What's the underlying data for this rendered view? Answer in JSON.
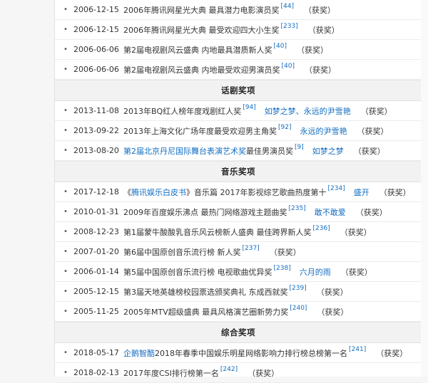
{
  "rows": [
    {
      "date": "2006-12-15",
      "pre": "",
      "link": "",
      "event": "2006年腾讯网星光大典 最具潜力电影演员奖",
      "ref": "[44]",
      "work": "",
      "result": "（获奖）"
    },
    {
      "date": "2006-12-15",
      "pre": "",
      "link": "",
      "event": "2006年腾讯网星光大典 最受欢迎四大小生奖",
      "ref": "[233]",
      "work": "",
      "result": "（获奖）"
    },
    {
      "date": "2006-06-06",
      "pre": "",
      "link": "",
      "event": "第2届电视剧风云盛典 内地最具潜质新人奖",
      "ref": "[40]",
      "work": "",
      "result": "（获奖）"
    },
    {
      "date": "2006-06-06",
      "pre": "",
      "link": "",
      "event": "第2届电视剧风云盛典 内地最受欢迎男演员奖",
      "ref": "[40]",
      "work": "",
      "result": "（获奖）"
    }
  ],
  "sections": {
    "drama": "话剧奖项",
    "music": "音乐奖项",
    "general": "综合奖项"
  },
  "drama_rows": [
    {
      "date": "2013-11-08",
      "pre": "",
      "link": "",
      "event": "2013年BQ红人榜年度戏剧红人奖",
      "ref": "[94]",
      "work": "如梦之梦、永远的尹雪艳",
      "result": "（获奖）"
    },
    {
      "date": "2013-09-22",
      "pre": "",
      "link": "",
      "event": "2013年上海文化广场年度最受欢迎男主角奖",
      "ref": "[92]",
      "work": "永远的尹雪艳",
      "result": "（获奖）"
    },
    {
      "date": "2013-08-20",
      "pre": "",
      "link": "第2届北京丹尼国际舞台表演艺术奖",
      "event": "最佳男演员奖",
      "ref": "[9]",
      "work": "如梦之梦",
      "result": "（获奖）"
    }
  ],
  "music_rows": [
    {
      "date": "2017-12-18",
      "pre": "《",
      "link": "腾讯娱乐白皮书",
      "event": "》音乐篇 2017年影视综艺歌曲热度第十",
      "ref": "[234]",
      "work": "盛开",
      "result": "（获奖）"
    },
    {
      "date": "2010-01-31",
      "pre": "",
      "link": "",
      "event": "2009年百度娱乐沸点 最热门网络游戏主题曲奖",
      "ref": "[235]",
      "work": "敢不敢爱",
      "result": "（获奖）"
    },
    {
      "date": "2008-12-23",
      "pre": "",
      "link": "",
      "event": "第1届蒙牛酸酸乳音乐风云榜新人盛典 最佳跨界新人奖",
      "ref": "[236]",
      "work": "",
      "result": "（获奖）"
    },
    {
      "date": "2007-01-20",
      "pre": "",
      "link": "",
      "event": "第6届中国原创音乐流行榜 新人奖",
      "ref": "[237]",
      "work": "",
      "result": "（获奖）"
    },
    {
      "date": "2006-01-14",
      "pre": "",
      "link": "",
      "event": "第5届中国原创音乐流行榜 电视歌曲优异奖",
      "ref": "[238]",
      "work": "六月的雨",
      "result": "（获奖）"
    },
    {
      "date": "2005-12-15",
      "pre": "",
      "link": "",
      "event": "第3届天地英雄榜校园票选颁奖典礼 东成西就奖",
      "ref": "[239]",
      "work": "",
      "result": "（获奖）"
    },
    {
      "date": "2005-11-25",
      "pre": "",
      "link": "",
      "event": "2005年MTV超级盛典 最具风格演艺圈新势力奖",
      "ref": "[240]",
      "work": "",
      "result": "（获奖）"
    }
  ],
  "general_rows": [
    {
      "date": "2018-05-17",
      "pre": "",
      "link": "企鹅智酷",
      "event": "2018年春季中国娱乐明星网络影响力排行榜总榜第一名",
      "ref": "[241]",
      "work": "",
      "result": "（获奖）"
    },
    {
      "date": "2018-02-13",
      "pre": "",
      "link": "",
      "event": "2017年度CSI排行榜第一名",
      "ref": "[242]",
      "work": "",
      "result": "（获奖）"
    }
  ]
}
